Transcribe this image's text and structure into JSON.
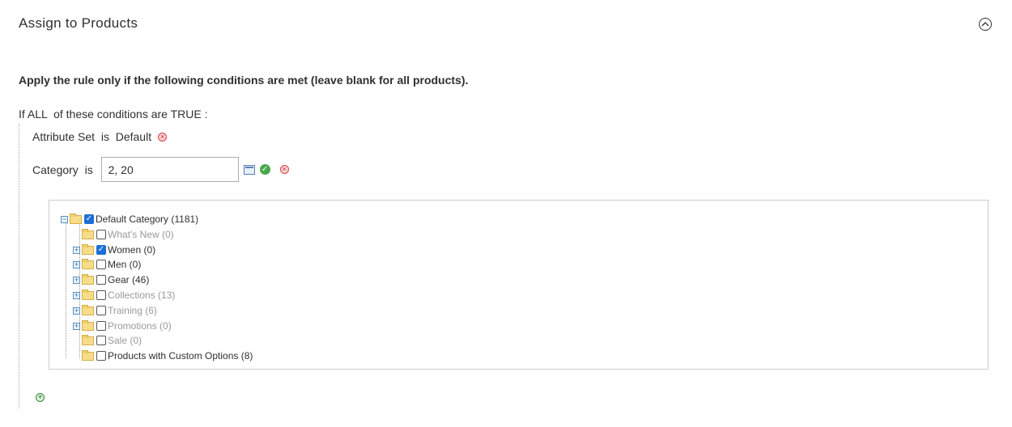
{
  "section": {
    "title": "Assign to Products",
    "collapse_icon": "chevron-up-icon"
  },
  "conditions": {
    "description": "Apply the rule only if the following conditions are met (leave blank for all products).",
    "if_prefix": "If",
    "aggregator": "ALL",
    "middle": "of these conditions are",
    "value": "TRUE",
    "suffix": ":",
    "rows": [
      {
        "attribute": "Attribute Set",
        "operator": "is",
        "value": "Default"
      },
      {
        "attribute": "Category",
        "operator": "is",
        "value": "2, 20"
      }
    ]
  },
  "tree": {
    "root": {
      "label": "Default Category (1181)",
      "checked": true
    },
    "children": [
      {
        "label": "What's New (0)",
        "checked": false,
        "dim": true,
        "expandable": false
      },
      {
        "label": "Women (0)",
        "checked": true,
        "dim": false,
        "expandable": true
      },
      {
        "label": "Men (0)",
        "checked": false,
        "dim": false,
        "expandable": true
      },
      {
        "label": "Gear (46)",
        "checked": false,
        "dim": false,
        "expandable": true
      },
      {
        "label": "Collections (13)",
        "checked": false,
        "dim": true,
        "expandable": true
      },
      {
        "label": "Training (6)",
        "checked": false,
        "dim": true,
        "expandable": true
      },
      {
        "label": "Promotions (0)",
        "checked": false,
        "dim": true,
        "expandable": true
      },
      {
        "label": "Sale (0)",
        "checked": false,
        "dim": true,
        "expandable": false
      },
      {
        "label": "Products with Custom Options (8)",
        "checked": false,
        "dim": false,
        "expandable": false
      }
    ]
  },
  "colors": {
    "text": "#303030",
    "dim_text": "#9a9a9a",
    "checkbox_checked": "#1b6fd6",
    "remove": "#d94040",
    "apply": "#49a84a"
  }
}
